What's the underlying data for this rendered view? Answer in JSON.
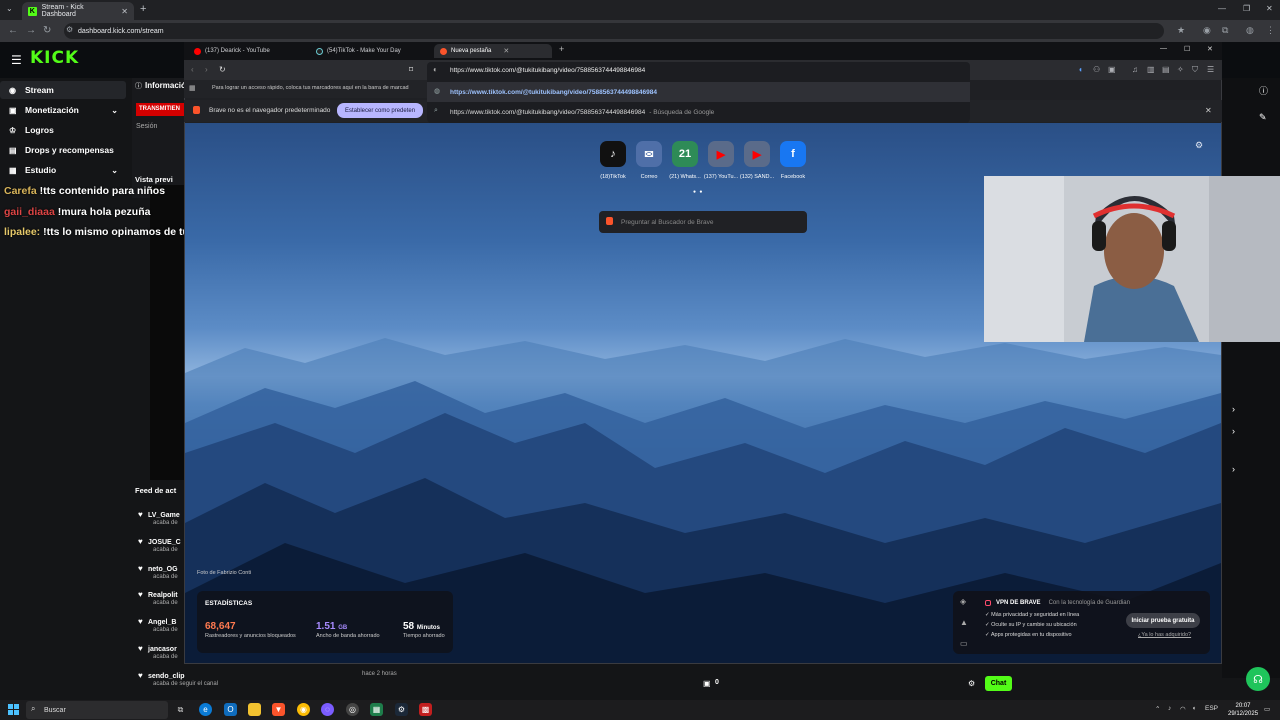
{
  "chrome": {
    "tab_title": "Stream - Kick Dashboard",
    "new_tab": "+",
    "url": "dashboard.kick.com/stream"
  },
  "kick": {
    "logo": "KICK",
    "sidebar": {
      "items": [
        {
          "label": "Stream",
          "icon": "broadcast-icon"
        },
        {
          "label": "Monetización",
          "icon": "money-icon"
        },
        {
          "label": "Logros",
          "icon": "trophy-icon"
        },
        {
          "label": "Drops y recompensas",
          "icon": "gift-icon"
        },
        {
          "label": "Estudio",
          "icon": "studio-icon"
        }
      ]
    },
    "chat_overlay": [
      {
        "user": "Carefa",
        "message": "!tts contenido para niños"
      },
      {
        "user": "gaii_diaaa",
        "message": "!mura hola pezuña"
      },
      {
        "user": "lipalee:",
        "message": "!tts lo mismo opinamos de tu contenido"
      }
    ],
    "info_title": "Informació",
    "transmit_badge": "TRANSMITIEN",
    "session_label": "Sesión",
    "preview_title": "Vista previ",
    "feed_title": "Feed de act",
    "feed": [
      {
        "name": "LV_Game",
        "sub": "acaba de"
      },
      {
        "name": "JOSUE_C",
        "sub": "acaba de"
      },
      {
        "name": "neto_OG",
        "sub": "acaba de"
      },
      {
        "name": "Realpolit",
        "sub": "acaba de"
      },
      {
        "name": "Angel_B",
        "sub": "acaba de"
      },
      {
        "name": "jancasor",
        "sub": "acaba de"
      },
      {
        "name": "sendo_clip",
        "sub": "acaba de seguir el canal",
        "time": "hace 2 horas"
      }
    ],
    "chat_button": "Chat",
    "gift_count": "0"
  },
  "brave": {
    "tabs": [
      {
        "title": "(137) Dearick - YouTube"
      },
      {
        "title": "(54)TikTok - Make Your Day"
      },
      {
        "title": "Nueva pestaña"
      }
    ],
    "omnibox_value": "https://www.tiktok.com/@tukitukibang/video/7588563744498846984",
    "suggestions": [
      {
        "text": "https://www.tiktok.com/@tukitukibang/video/7588563744498846984",
        "sub": ""
      },
      {
        "text": "https://www.tiktok.com/@tukitukibang/video/7588563744498846984",
        "sub": "- Búsqueda de Google"
      }
    ],
    "bookmarks_hint": "Para lograr un acceso rápido, coloca tus marcadores aquí en la barra de marcad",
    "infobar_text": "Brave no es el navegador predeterminado",
    "infobar_button": "Establecer como predeten",
    "speed_dials": [
      {
        "label": "(18)TikTok",
        "icon": "tiktok-icon",
        "glyph": "♪"
      },
      {
        "label": "Correo",
        "icon": "mail-icon",
        "glyph": "✉"
      },
      {
        "label": "(21) Whats...",
        "icon": "whatsapp-icon",
        "glyph": "21"
      },
      {
        "label": "(137) YouTu...",
        "icon": "youtube-icon",
        "glyph": "▶"
      },
      {
        "label": "(132) SAND...",
        "icon": "youtube-icon",
        "glyph": "▶"
      },
      {
        "label": "Facebook",
        "icon": "facebook-icon",
        "glyph": "f"
      }
    ],
    "search_placeholder": "Preguntar al Buscador de Brave",
    "photo_credit": "Foto de Fabrizio Conti",
    "stats": {
      "title": "ESTADÍSTICAS",
      "items": [
        {
          "value": "68,647",
          "unit": "",
          "label": "Rastreadores y anuncios bloqueados",
          "color": "#ff7a50"
        },
        {
          "value": "1.51",
          "unit": "GB",
          "label": "Ancho de banda ahorrado",
          "color": "#a78bff"
        },
        {
          "value": "58",
          "unit": "Minutos",
          "label": "Tiempo ahorrado",
          "color": "#ffffff"
        }
      ]
    },
    "vpn": {
      "title": "VPN DE BRAVE",
      "subtitle": "Con la tecnología de Guardian",
      "items": [
        "Más privacidad y seguridad en línea",
        "Oculte su IP y cambie su ubicación",
        "Apps protegidas en tu dispositivo"
      ],
      "button": "Iniciar prueba gratuita",
      "link": "¿Ya lo has adquirido?"
    }
  },
  "taskbar": {
    "search_placeholder": "Buscar",
    "language": "ESP",
    "time": "20:07",
    "date": "29/12/2025"
  }
}
